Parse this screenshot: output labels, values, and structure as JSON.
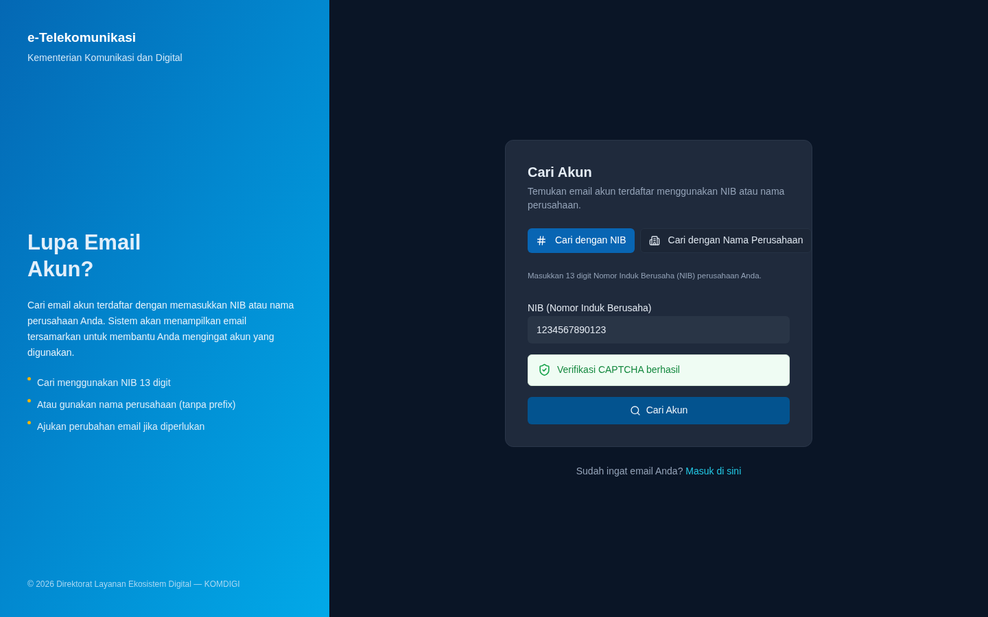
{
  "brand": {
    "title": "e-Telekomunikasi",
    "subtitle": "Kementerian Komunikasi dan Digital"
  },
  "hero": {
    "heading": "Lupa Email Akun?",
    "description": "Cari email akun terdaftar dengan memasukkan NIB atau nama perusahaan Anda. Sistem akan menampilkan email tersamarkan untuk membantu Anda mengingat akun yang digunakan.",
    "bullets": [
      "Cari menggunakan NIB 13 digit",
      "Atau gunakan nama perusahaan (tanpa prefix)",
      "Ajukan perubahan email jika diperlukan"
    ]
  },
  "footer": "© 2026 Direktorat Layanan Ekosistem Digital — KOMDIGI",
  "card": {
    "title": "Cari Akun",
    "description": "Temukan email akun terdaftar menggunakan NIB atau nama perusahaan.",
    "tabs": [
      {
        "label": "Cari dengan NIB",
        "kind": "nib",
        "selected": true
      },
      {
        "label": "Cari dengan Nama Perusahaan",
        "kind": "company",
        "selected": false
      }
    ],
    "hint": "Masukkan 13 digit Nomor Induk Berusaha (NIB) perusahaan Anda.",
    "field": {
      "label": "NIB (Nomor Induk Berusaha)",
      "value": "1234567890123"
    },
    "captcha": {
      "text": "Verifikasi CAPTCHA berhasil",
      "verified": true
    },
    "submit": "Cari Akun"
  },
  "login_prompt": {
    "text": "Sudah ingat email Anda?",
    "link": "Masuk di sini"
  }
}
